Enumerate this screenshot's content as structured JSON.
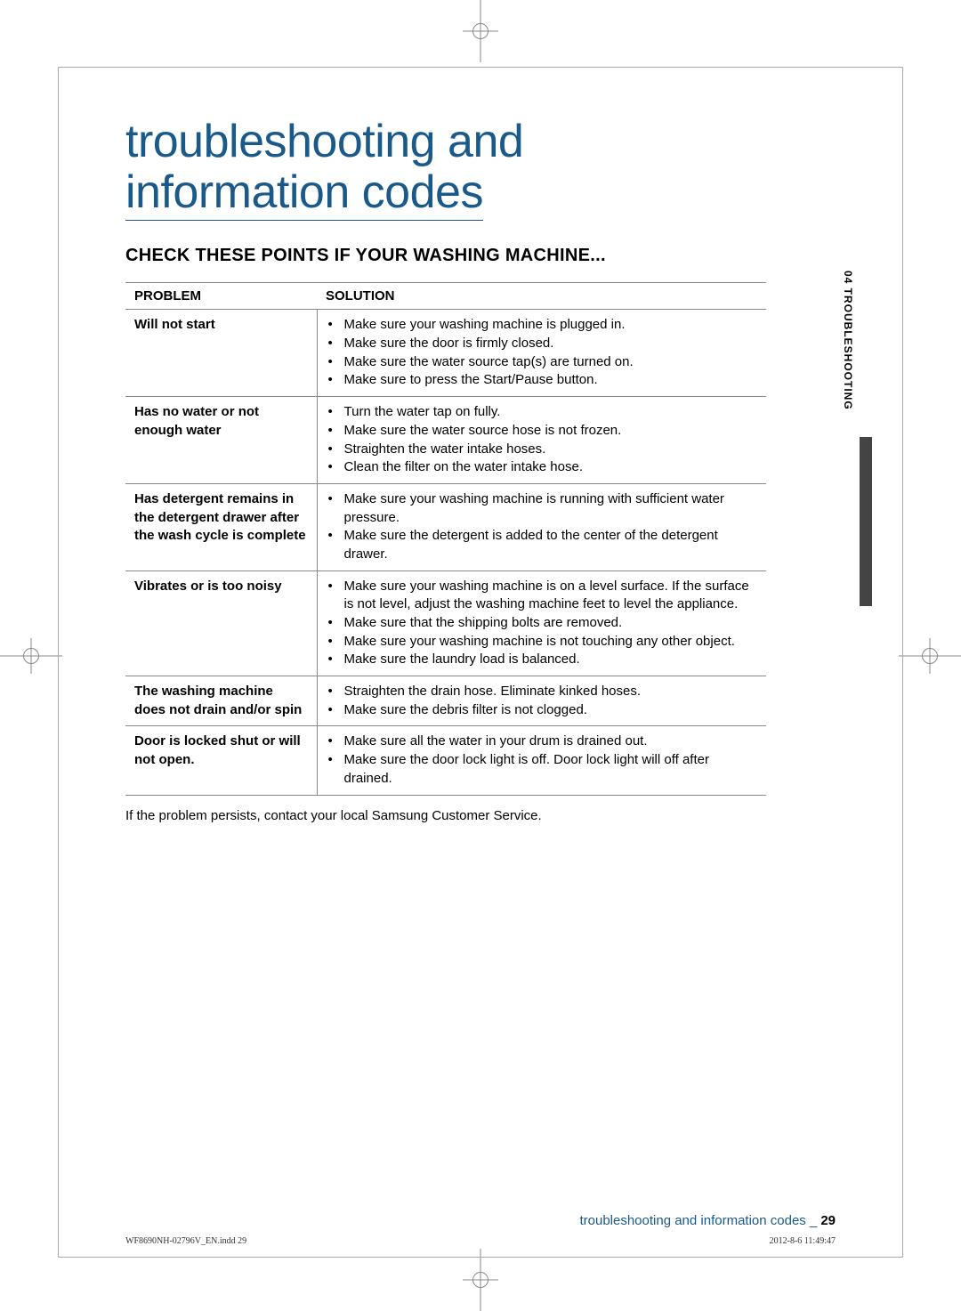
{
  "title_line1": "troubleshooting and",
  "title_line2": "information codes",
  "section_heading": "CHECK THESE POINTS IF YOUR WASHING MACHINE...",
  "table": {
    "headers": {
      "problem": "PROBLEM",
      "solution": "SOLUTION"
    },
    "rows": [
      {
        "problem": "Will not start",
        "solutions": [
          "Make sure your washing machine is plugged in.",
          "Make sure the door is firmly closed.",
          "Make sure the water source tap(s) are turned on.",
          "Make sure to press the Start/Pause button."
        ]
      },
      {
        "problem": "Has no water or not enough water",
        "solutions": [
          "Turn the water tap on fully.",
          "Make sure the water source hose is not frozen.",
          "Straighten the water intake hoses.",
          "Clean the filter on the water intake hose."
        ]
      },
      {
        "problem": "Has detergent remains in the detergent drawer after the wash cycle is complete",
        "solutions": [
          "Make sure your washing machine is running with sufficient water pressure.",
          "Make sure the detergent is added to the center of the detergent drawer."
        ]
      },
      {
        "problem": "Vibrates or is too noisy",
        "solutions": [
          "Make sure your washing machine is on a level surface. If the surface is not level, adjust the washing machine feet to level the appliance.",
          "Make sure that the shipping bolts are removed.",
          "Make sure your washing machine is not touching any other object.",
          "Make sure the laundry load is balanced."
        ]
      },
      {
        "problem": "The washing machine does not drain and/or spin",
        "solutions": [
          "Straighten the drain hose. Eliminate kinked hoses.",
          "Make sure the debris filter is not clogged."
        ]
      },
      {
        "problem": "Door is locked shut or will not open.",
        "solutions": [
          "Make sure all the water in your drum is drained out.",
          "Make sure the door lock light is off. Door lock light will off after drained."
        ]
      }
    ]
  },
  "footnote": "If the problem persists, contact your local Samsung Customer Service.",
  "side_tab": "04 TROUBLESHOOTING",
  "footer_text": "troubleshooting and information codes _",
  "page_number": "29",
  "indd_left": "WF8690NH-02796V_EN.indd   29",
  "indd_right": "2012-8-6   11:49:47"
}
